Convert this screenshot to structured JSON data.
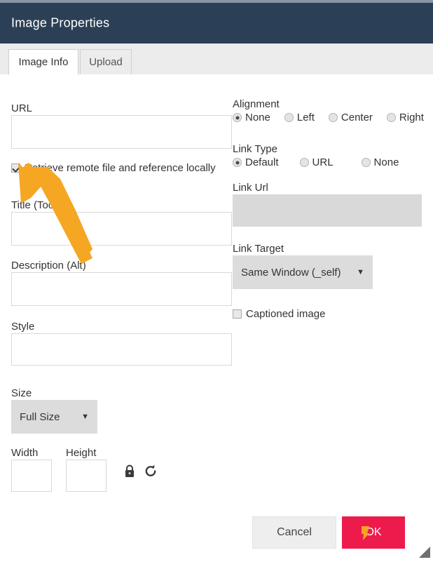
{
  "dialog": {
    "title": "Image Properties",
    "accent_header_color": "#2b4056",
    "ok_color": "#ed1b4c",
    "annotation_color": "#f5a623"
  },
  "tabs": [
    {
      "label": "Image Info",
      "active": true
    },
    {
      "label": "Upload",
      "active": false
    }
  ],
  "left_column": {
    "url": {
      "label": "URL",
      "value": "",
      "placeholder": ""
    },
    "retrieve_remote": {
      "label": "Retrieve remote file and reference locally",
      "checked": true
    },
    "title_tooltip": {
      "label": "Title (Tooltip)",
      "value": "",
      "placeholder": ""
    },
    "description_alt": {
      "label": "Description (Alt)",
      "value": "",
      "placeholder": ""
    },
    "style": {
      "label": "Style",
      "value": "",
      "placeholder": ""
    },
    "size": {
      "label": "Size",
      "value": "Full Size",
      "caret": "▼"
    },
    "width": {
      "label": "Width",
      "value": "",
      "placeholder": ""
    },
    "height": {
      "label": "Height",
      "value": "",
      "placeholder": ""
    },
    "lock_icon": "lock-icon",
    "reset_icon": "reset-icon"
  },
  "right_column": {
    "alignment": {
      "label": "Alignment",
      "options": [
        {
          "label": "None",
          "selected": true
        },
        {
          "label": "Left",
          "selected": false
        },
        {
          "label": "Center",
          "selected": false
        },
        {
          "label": "Right",
          "selected": false
        }
      ]
    },
    "link_type": {
      "label": "Link Type",
      "options": [
        {
          "label": "Default",
          "selected": true
        },
        {
          "label": "URL",
          "selected": false
        },
        {
          "label": "None",
          "selected": false
        }
      ]
    },
    "link_url": {
      "label": "Link Url",
      "value": "",
      "disabled": true
    },
    "link_target": {
      "label": "Link Target",
      "value": "Same Window (_self)",
      "caret": "▼"
    },
    "captioned_image": {
      "label": "Captioned image",
      "checked": false
    }
  },
  "footer": {
    "cancel_label": "Cancel",
    "ok_label": "OK"
  }
}
